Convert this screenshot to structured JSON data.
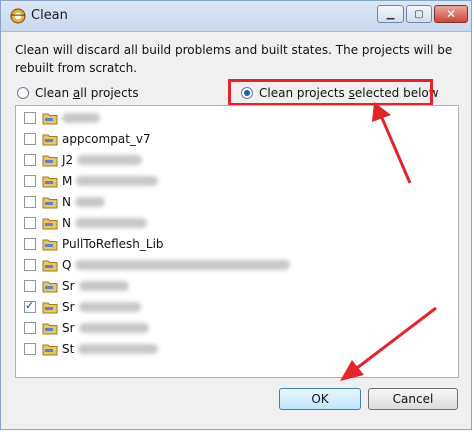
{
  "window": {
    "title": "Clean"
  },
  "description": "Clean will discard all build problems and built states.  The projects will be rebuilt from scratch.",
  "options": {
    "clean_all": {
      "prefix": "Clean ",
      "mnemonic": "a",
      "suffix": "ll projects"
    },
    "clean_selected": {
      "prefix": "Clean projects ",
      "mnemonic": "s",
      "suffix": "elected below"
    }
  },
  "projects": [
    {
      "label": "",
      "checked": false
    },
    {
      "label": "appcompat_v7",
      "checked": false
    },
    {
      "label": "J2",
      "checked": false
    },
    {
      "label": "M",
      "checked": false
    },
    {
      "label": "N",
      "checked": false
    },
    {
      "label": "N",
      "checked": false
    },
    {
      "label": "PullToReflesh_Lib",
      "checked": false
    },
    {
      "label": "Q",
      "checked": false
    },
    {
      "label": "Sr",
      "checked": false
    },
    {
      "label": "Sr",
      "checked": true
    },
    {
      "label": "Sr",
      "checked": false
    },
    {
      "label": "St",
      "checked": false
    }
  ],
  "buttons": {
    "ok": "OK",
    "cancel": "Cancel"
  },
  "colors": {
    "annotation": "#e1262b",
    "selected_dot": "#1a5fb4"
  }
}
